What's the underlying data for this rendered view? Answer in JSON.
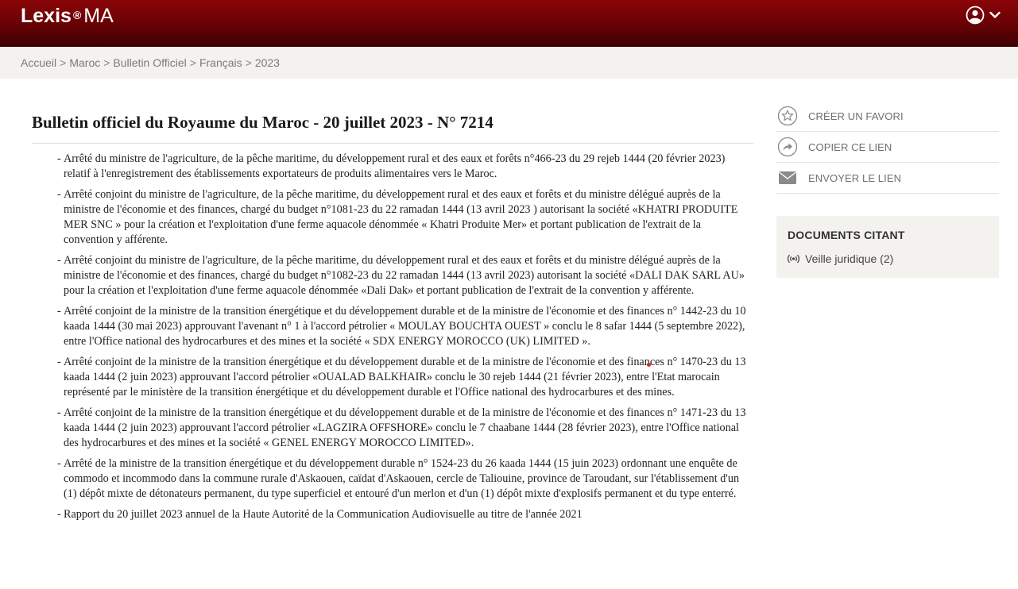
{
  "header": {
    "brand": "Lexis",
    "reg": "®",
    "region": "MA",
    "colors": {
      "bar_top": "#8a0508",
      "bar_bottom": "#3e0002"
    }
  },
  "breadcrumb": {
    "items": [
      "Accueil",
      "Maroc",
      "Bulletin Officiel",
      "Français",
      "2023"
    ],
    "separator": ">"
  },
  "document": {
    "title": "Bulletin officiel du Royaume du Maroc - 20 juillet 2023 - N° 7214",
    "entries": [
      "Arrêté du ministre de l'agriculture, de la pêche maritime, du développement rural et des eaux et forêts n°466-23 du 29 rejeb 1444 (20 février 2023) relatif à l'enregistrement des établissements exportateurs de produits alimentaires vers le Maroc.",
      "Arrêté conjoint du ministre de l'agriculture, de la pêche maritime, du développement rural et des eaux et forêts et du ministre délégué auprès de la ministre de l'économie et des finances, chargé du budget n°1081-23 du 22 ramadan 1444 (13 avril 2023 ) autorisant la société «KHATRI PRODUITE MER SNC » pour la création et l'exploitation d'une ferme aquacole dénommée « Khatri Produite Mer» et portant publication de l'extrait de la convention y afférente.",
      "Arrêté conjoint du ministre de l'agriculture, de la pêche maritime, du développement rural et des eaux et forêts et du ministre délégué auprès de la ministre de l'économie et des finances, chargé du budget n°1082-23 du 22 ramadan 1444 (13 avril 2023) autorisant la société «DALI DAK SARL AU» pour la création et l'exploitation d'une ferme aquacole dénommée «Dali Dak» et portant publication de l'extrait de la convention y afférente.",
      "Arrêté conjoint de la ministre de la transition énergétique et du développement durable et de la ministre de l'économie et des finances n° 1442-23 du 10 kaada 1444 (30 mai 2023) approuvant l'avenant n° 1 à l'accord pétrolier « MOULAY BOUCHTA OUEST » conclu le 8 safar 1444 (5 septembre 2022), entre l'Office national des hydrocarbures et des mines et la société « SDX ENERGY MOROCCO (UK) LIMITED ».",
      "Arrêté conjoint de la ministre de la transition énergétique et du développement durable et de la ministre de l'économie et des finances n° 1470-23 du 13 kaada 1444 (2 juin 2023) approuvant l'accord pétrolier «OUALAD BALKHAIR» conclu le 30 rejeb 1444 (21 février 2023), entre l'Etat marocain représenté par le ministère de la transition énergétique et du développement durable et l'Office national des hydrocarbures et des mines.",
      "Arrêté conjoint de la ministre de la transition énergétique et du développement durable et de la ministre de l'économie et des finances n° 1471-23 du 13 kaada 1444 (2 juin 2023) approuvant l'accord pétrolier «LAGZIRA OFFSHORE» conclu le 7 chaabane 1444 (28 février 2023), entre l'Office national des hydrocarbures et des mines et la société « GENEL ENERGY MOROCCO LIMITED».",
      "Arrêté de la ministre de la transition énergétique et du développement durable n° 1524-23 du 26 kaada 1444 (15 juin 2023) ordonnant une enquête de commodo et incommodo dans la commune rurale d'Askaouen, caïdat d'Askaouen, cercle de Taliouine, province de Taroudant, sur l'établissement d'un (1) dépôt mixte de détonateurs permanent, du type superficiel et entouré d'un merlon et d'un (1) dépôt mixte d'explosifs permanent et du type enterré.",
      "Rapport du 20 juillet 2023 annuel de la Haute Autorité de la Communication Audiovisuelle au titre de l'année 2021"
    ]
  },
  "sidebar": {
    "actions": [
      {
        "label": "CRÉER UN FAVORI",
        "icon": "star-icon"
      },
      {
        "label": "COPIER CE LIEN",
        "icon": "share-arrow-icon"
      },
      {
        "label": "ENVOYER LE LIEN",
        "icon": "envelope-icon"
      }
    ],
    "cited": {
      "title": "DOCUMENTS CITANT",
      "items": [
        {
          "label": "Veille juridique (2)",
          "icon": "broadcast-icon"
        }
      ]
    }
  }
}
